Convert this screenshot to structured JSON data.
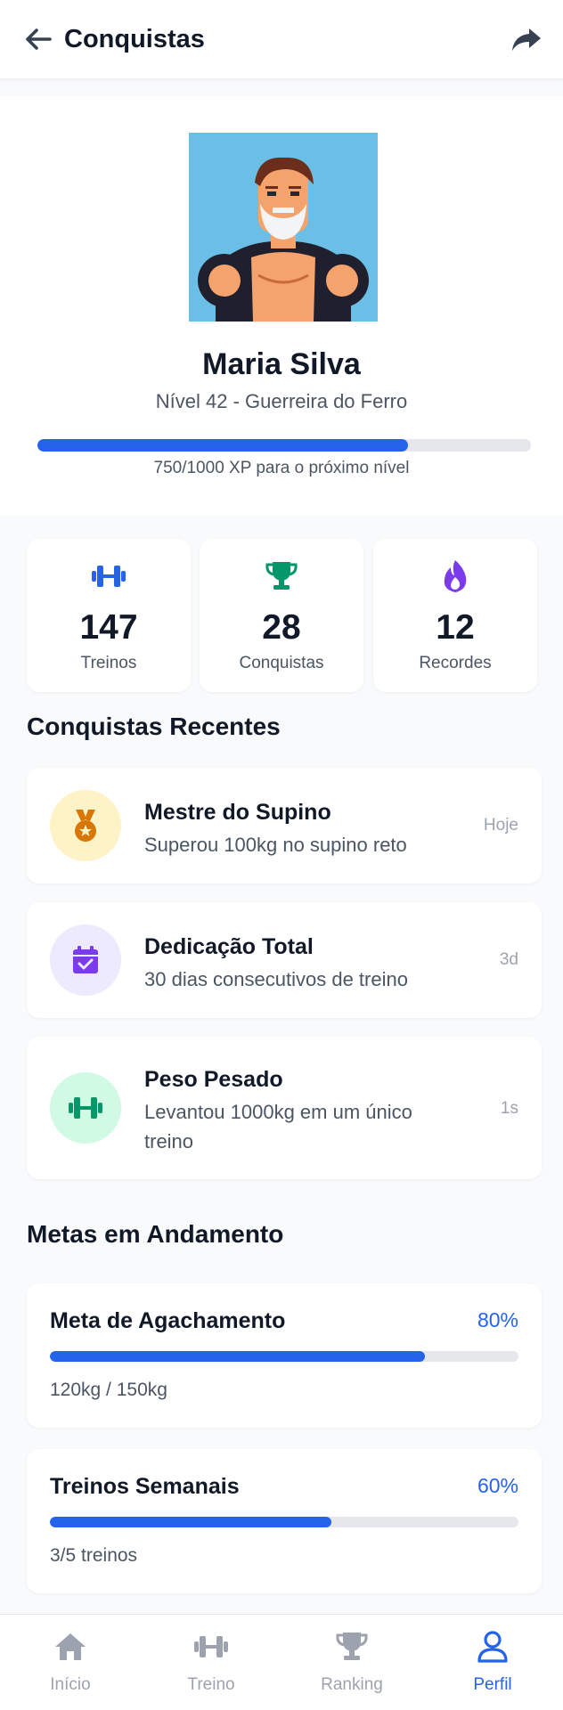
{
  "header": {
    "title": "Conquistas",
    "back_icon": "arrow-left-icon",
    "share_icon": "share-icon"
  },
  "profile": {
    "name": "Maria Silva",
    "level": "Nível 42 - Guerreira do Ferro",
    "xp_current": 750,
    "xp_total": 1000,
    "xp_text": "750/1000 XP para o próximo nível"
  },
  "stats": [
    {
      "icon": "dumbbell-icon",
      "value": "147",
      "label": "Treinos",
      "color": "#2563eb"
    },
    {
      "icon": "trophy-icon",
      "value": "28",
      "label": "Conquistas",
      "color": "#059669"
    },
    {
      "icon": "fire-icon",
      "value": "12",
      "label": "Recordes",
      "color": "#7c3aed"
    }
  ],
  "recent": {
    "title": "Conquistas Recentes",
    "items": [
      {
        "icon": "medal-icon",
        "title": "Mestre do Supino",
        "desc": "Superou 100kg no supino reto",
        "time": "Hoje",
        "bg": "#fef3c7",
        "fg": "#d97706"
      },
      {
        "icon": "calendar-check-icon",
        "title": "Dedicação Total",
        "desc": "30 dias consecutivos de treino",
        "time": "3d",
        "bg": "#ede9fe",
        "fg": "#7c3aed"
      },
      {
        "icon": "dumbbell-icon",
        "title": "Peso Pesado",
        "desc": "Levantou 1000kg em um único treino",
        "time": "1s",
        "bg": "#d1fae5",
        "fg": "#059669"
      }
    ]
  },
  "goals": {
    "title": "Metas em Andamento",
    "items": [
      {
        "title": "Meta de Agachamento",
        "percent_label": "80%",
        "progress": 0.8,
        "detail": "120kg / 150kg"
      },
      {
        "title": "Treinos Semanais",
        "percent_label": "60%",
        "progress": 0.6,
        "detail": "3/5 treinos"
      }
    ]
  },
  "nav": [
    {
      "icon": "home-icon",
      "label": "Início",
      "active": false
    },
    {
      "icon": "dumbbell-icon",
      "label": "Treino",
      "active": false
    },
    {
      "icon": "trophy-icon",
      "label": "Ranking",
      "active": false
    },
    {
      "icon": "user-icon",
      "label": "Perfil",
      "active": true
    }
  ],
  "colors": {
    "accent": "#2563eb",
    "inactive": "#9ca3af"
  }
}
